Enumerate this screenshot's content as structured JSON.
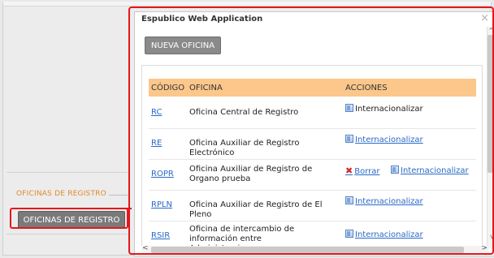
{
  "sidebar": {
    "section_heading": "OFICINAS DE REGISTRO",
    "button_label": "OFICINAS DE REGISTRO"
  },
  "dialog": {
    "title": "Espublico Web Application",
    "close_label": "×",
    "new_office_label": "NUEVA OFICINA",
    "columns": [
      "CÓDIGO",
      "OFICINA",
      "ACCIONES"
    ],
    "rows": [
      {
        "code": "RC",
        "name": "Oficina Central de Registro",
        "actions": [
          {
            "type": "internationalize",
            "label": "Internacionalizar",
            "link": false
          }
        ]
      },
      {
        "code": "RE",
        "name": "Oficina Auxiliar de Registro Electrónico",
        "actions": [
          {
            "type": "internationalize",
            "label": "Internacionalizar",
            "link": true
          }
        ]
      },
      {
        "code": "ROPR",
        "name": "Oficina Auxiliar de Registro de Organo prueba",
        "actions": [
          {
            "type": "delete",
            "label": "Borrar",
            "link": true
          },
          {
            "type": "internationalize",
            "label": "Internacionalizar",
            "link": true
          }
        ]
      },
      {
        "code": "RPLN",
        "name": "Oficina Auxiliar de Registro de El Pleno",
        "actions": [
          {
            "type": "internationalize",
            "label": "Internacionalizar",
            "link": true
          }
        ]
      },
      {
        "code": "RSIR",
        "name": "Oficina de intercambio de información entre Administraciones",
        "actions": [
          {
            "type": "internationalize",
            "label": "Internacionalizar",
            "link": true
          }
        ]
      }
    ]
  },
  "colors": {
    "highlight": "#e3171b",
    "table_header": "#fbc78b",
    "link": "#2a6ac7",
    "section_heading": "#e08a2a"
  }
}
